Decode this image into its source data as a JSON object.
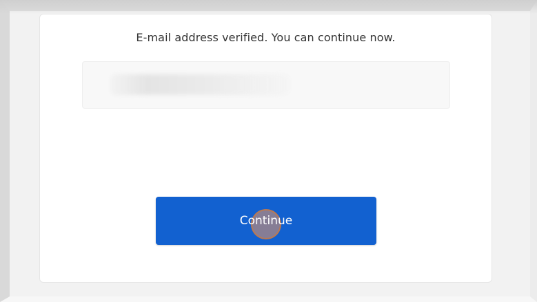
{
  "verification": {
    "message": "E-mail address verified. You can continue now."
  },
  "actions": {
    "continue_label": "Continue"
  },
  "colors": {
    "primary_button": "#1261d0",
    "click_indicator": "#e6966e"
  }
}
